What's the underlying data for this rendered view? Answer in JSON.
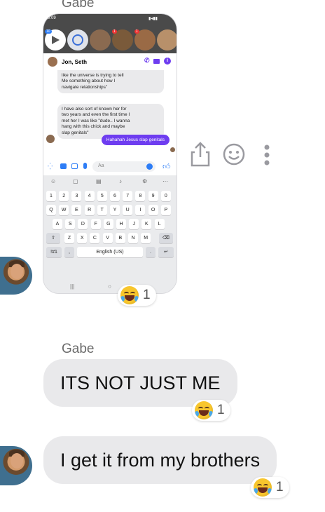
{
  "thread": {
    "messages": [
      {
        "sender": "Gabe",
        "type": "image",
        "reaction": {
          "emoji": "rolling-laughing",
          "count": "1"
        }
      },
      {
        "sender": "Gabe",
        "text": "ITS NOT JUST ME",
        "reaction": {
          "emoji": "rolling-laughing",
          "count": "1"
        }
      },
      {
        "text": "I get it from my brothers",
        "reaction": {
          "emoji": "rolling-laughing",
          "count": "1"
        }
      }
    ]
  },
  "shared_screenshot": {
    "status_time": "9:09",
    "badges": [
      "10",
      "1",
      "1"
    ],
    "chat_title": "Jon, Seth",
    "bubble1_lines": [
      "like the universe is trying to tell",
      "Me something about how I",
      "navigate relationships\""
    ],
    "bubble2_lines": [
      "I have also sort of known her for",
      "two years and even the first time I",
      "met her I was like \"dude.. I wanna",
      "hang with this chick and maybe",
      "slap genitals\""
    ],
    "sent_text": "Hahahah Jesus slap genitals",
    "composer_placeholder": "Aa",
    "keyboard": {
      "row_numbers": [
        "1",
        "2",
        "3",
        "4",
        "5",
        "6",
        "7",
        "8",
        "9",
        "0"
      ],
      "row1": [
        "Q",
        "W",
        "E",
        "R",
        "T",
        "Y",
        "U",
        "I",
        "O",
        "P"
      ],
      "row2": [
        "A",
        "S",
        "D",
        "F",
        "G",
        "H",
        "J",
        "K",
        "L"
      ],
      "row3": [
        "Z",
        "X",
        "C",
        "V",
        "B",
        "N",
        "M"
      ],
      "symbols_key": "!#1",
      "comma_key": ",",
      "space_label": "English (US)",
      "period_key": "."
    }
  },
  "colors": {
    "bubble": "#e9e9eb",
    "accent": "#6e3df0",
    "reaction_emoji": "#f8c62d"
  }
}
